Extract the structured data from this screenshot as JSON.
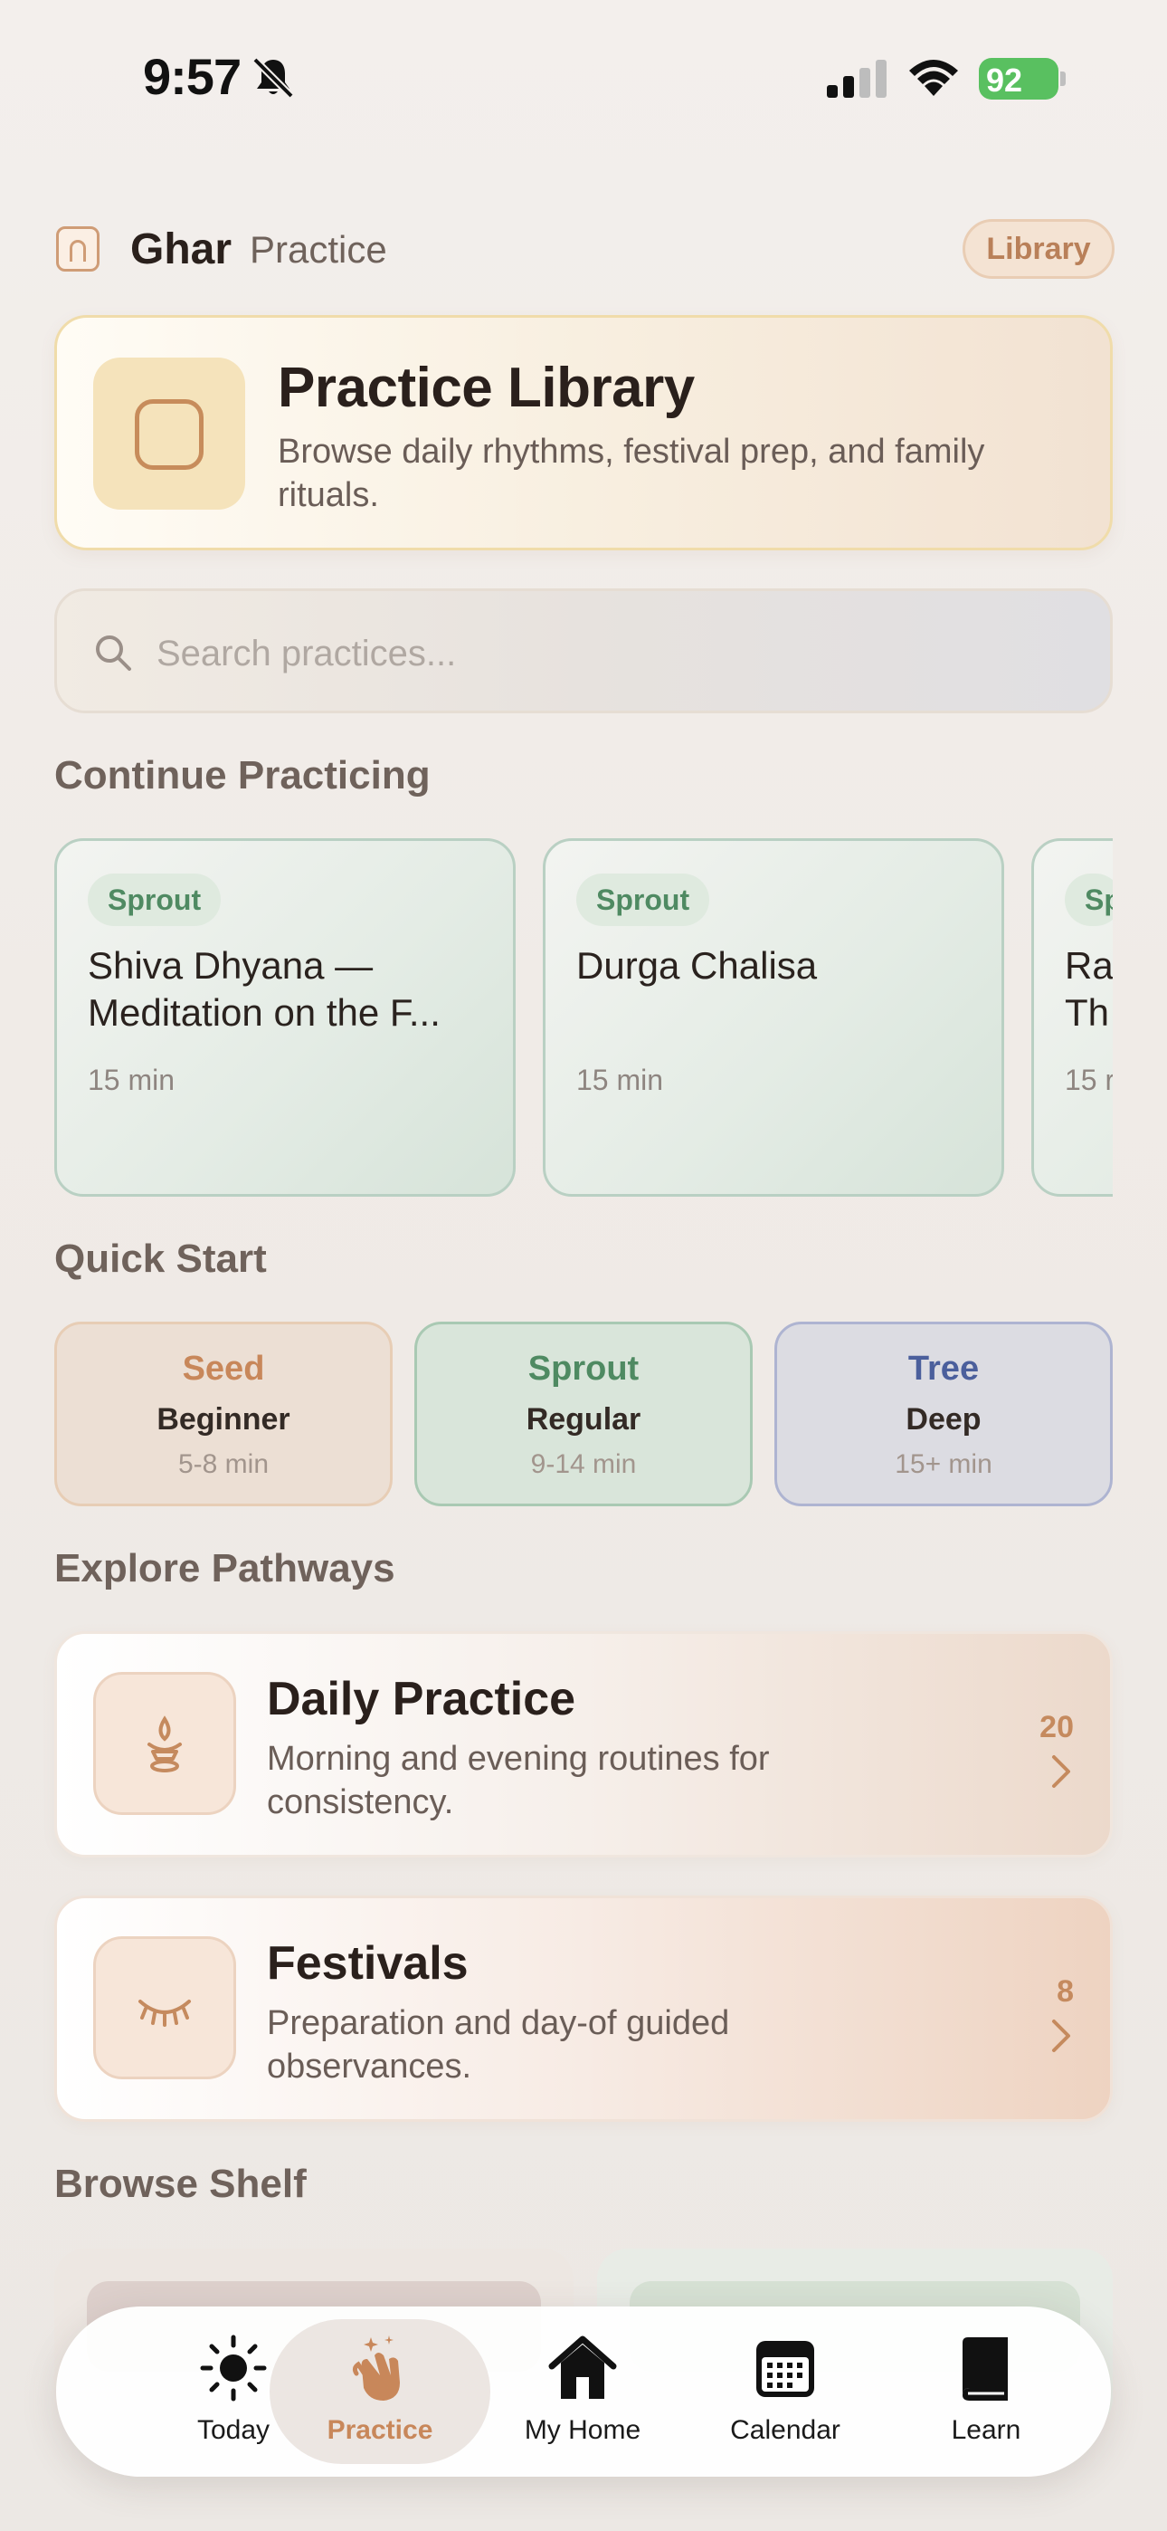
{
  "status_bar": {
    "time": "9:57",
    "battery": "92"
  },
  "header": {
    "title": "Ghar",
    "subtitle": "Practice",
    "library_label": "Library"
  },
  "hero": {
    "title": "Practice Library",
    "description": "Browse daily rhythms, festival prep, and family rituals."
  },
  "search": {
    "placeholder": "Search practices..."
  },
  "continue": {
    "title": "Continue Practicing",
    "cards": [
      {
        "badge": "Sprout",
        "title": "Shiva Dhyana — Meditation on the F...",
        "duration": "15 min"
      },
      {
        "badge": "Sprout",
        "title": "Durga Chalisa",
        "duration": "15 min"
      },
      {
        "badge": "Sp",
        "title": "Ra Th",
        "duration": "15 r"
      }
    ]
  },
  "quick_start": {
    "title": "Quick Start",
    "items": [
      {
        "label": "Seed",
        "level": "Beginner",
        "range": "5-8 min",
        "color": "#c8875a"
      },
      {
        "label": "Sprout",
        "level": "Regular",
        "range": "9-14 min",
        "color": "#4f8a62"
      },
      {
        "label": "Tree",
        "level": "Deep",
        "range": "15+ min",
        "color": "#4b5f9c"
      }
    ]
  },
  "pathways": {
    "title": "Explore Pathways",
    "items": [
      {
        "title": "Daily Practice",
        "description": "Morning and evening routines for consistency.",
        "count": "20",
        "icon": "diya-icon"
      },
      {
        "title": "Festivals",
        "description": "Preparation and day-of guided observances.",
        "count": "8",
        "icon": "closed-eye-icon"
      }
    ]
  },
  "browse_shelf": {
    "title": "Browse Shelf"
  },
  "tabs": [
    {
      "label": "Today",
      "icon": "sun-icon",
      "active": false
    },
    {
      "label": "Practice",
      "icon": "clapping-hands-icon",
      "active": true
    },
    {
      "label": "My Home",
      "icon": "house-icon",
      "active": false
    },
    {
      "label": "Calendar",
      "icon": "calendar-icon",
      "active": false
    },
    {
      "label": "Learn",
      "icon": "book-icon",
      "active": false
    }
  ],
  "colors": {
    "accent": "#c58a5e",
    "active_tab": "#c8875a"
  }
}
